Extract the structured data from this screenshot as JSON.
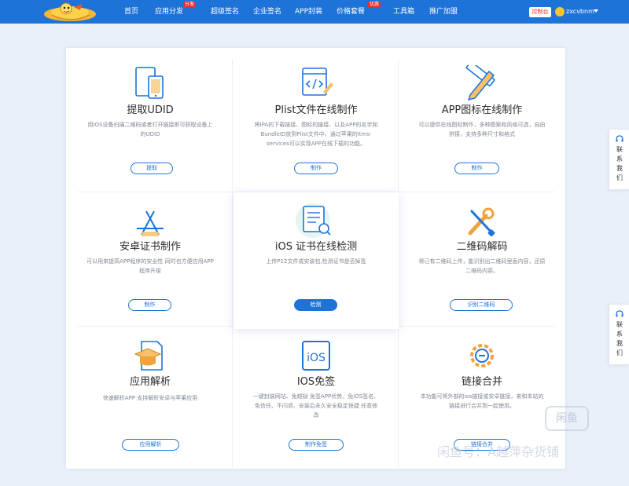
{
  "brand": {
    "logo_icon": "cartoon-mascot-logo"
  },
  "nav": {
    "items": [
      {
        "label": "首页"
      },
      {
        "label": "应用分发",
        "badge": "分发"
      },
      {
        "label": "超级签名"
      },
      {
        "label": "企业签名"
      },
      {
        "label": "APP封装"
      },
      {
        "label": "价格套餐",
        "badge": "优惠"
      },
      {
        "label": "工具箱"
      },
      {
        "label": "推广加盟"
      }
    ],
    "console_label": "控制台",
    "username": "zxcvbnm"
  },
  "tools": [
    {
      "title": "提取UDID",
      "desc": "用iOS设备扫描二维码或者打开链接即可获取设备上的UDID",
      "button": "提取",
      "icon": "devices-icon"
    },
    {
      "title": "Plist文件在线制作",
      "desc": "将IPA的下载链接、图标的链接、以及APP的名字和BundleID放到Plist文件中，通过苹果的itms-services可以实现APP在线下载的功能。",
      "button": "制作",
      "icon": "code-window-icon"
    },
    {
      "title": "APP图标在线制作",
      "desc": "可以提供在线图标制作，多种图案和风格可选，自由拼接，支持多种尺寸和格式",
      "button": "制作",
      "icon": "pencil-ruler-icon"
    },
    {
      "title": "安卓证书制作",
      "desc": "可以用来提高APP程序的安全性 同时也方便应用APP程序升级",
      "button": "制作",
      "icon": "app-store-icon"
    },
    {
      "title": "iOS 证书在线检测",
      "desc": "上传P12文件或安装包,检测证书是否掉签",
      "button": "检测",
      "icon": "document-check-icon"
    },
    {
      "title": "二维码解码",
      "desc": "将已有二维码上传，能识别出二维码里面内容，还原二维码内容。",
      "button": "识别二维码",
      "icon": "wrench-screwdriver-icon"
    },
    {
      "title": "应用解析",
      "desc": "快速解析APP 支持解析安卓与苹果应用",
      "button": "应用解析",
      "icon": "graduation-doc-icon"
    },
    {
      "title": "IOS免签",
      "desc": "一键封装网站、免越狱 免签APP优势、免iOS签名、免信任、不闪退、安装后永久安全稳定快捷 任意修改",
      "button": "制作免签",
      "icon": "ios-badge-icon"
    },
    {
      "title": "链接合并",
      "desc": "本功能可将外部的ios链接或安卓链接，来和本站的链接进行合并到一起使用。",
      "button": "链接合并",
      "icon": "gear-link-icon"
    }
  ],
  "side": {
    "contact": [
      "联",
      "系",
      "我",
      "们"
    ]
  },
  "watermark": {
    "logo": "闲鱼",
    "text": "闲鱼号：A越萍杂货铺"
  },
  "colors": {
    "primary": "#1e73d9",
    "badge": "#e8312b",
    "accent": "#f2a23b"
  }
}
